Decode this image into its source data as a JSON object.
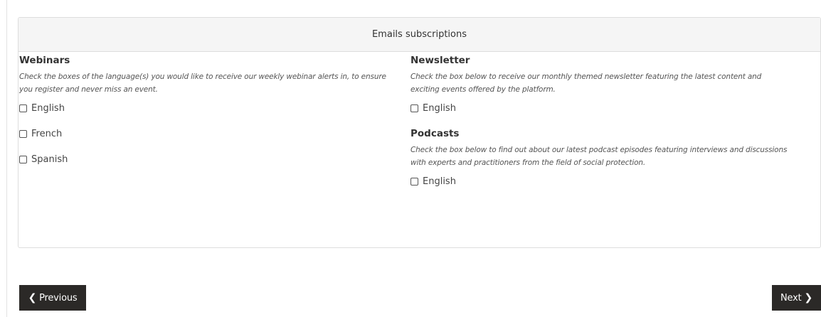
{
  "panel": {
    "title": "Emails subscriptions"
  },
  "webinars": {
    "title": "Webinars",
    "description": "Check the boxes of the language(s) you would like to receive our weekly webinar alerts in, to ensure you register and never miss an event.",
    "options": [
      "English",
      "French",
      "Spanish"
    ]
  },
  "newsletter": {
    "title": "Newsletter",
    "description": "Check the box below to receive our monthly themed newsletter featuring the latest content and exciting events offered by the platform.",
    "options": [
      "English"
    ]
  },
  "podcasts": {
    "title": "Podcasts",
    "description": "Check the box below to find out about our latest podcast episodes featuring interviews and discussions with experts and practitioners from the field of social protection.",
    "options": [
      "English"
    ]
  },
  "nav": {
    "previous_label": "Previous",
    "next_label": "Next",
    "previous_icon": "chevron-left-icon",
    "next_icon": "chevron-right-icon"
  },
  "colors": {
    "button_bg": "#2b2927",
    "panel_heading_bg": "#f5f5f5",
    "border": "#dddddd"
  }
}
